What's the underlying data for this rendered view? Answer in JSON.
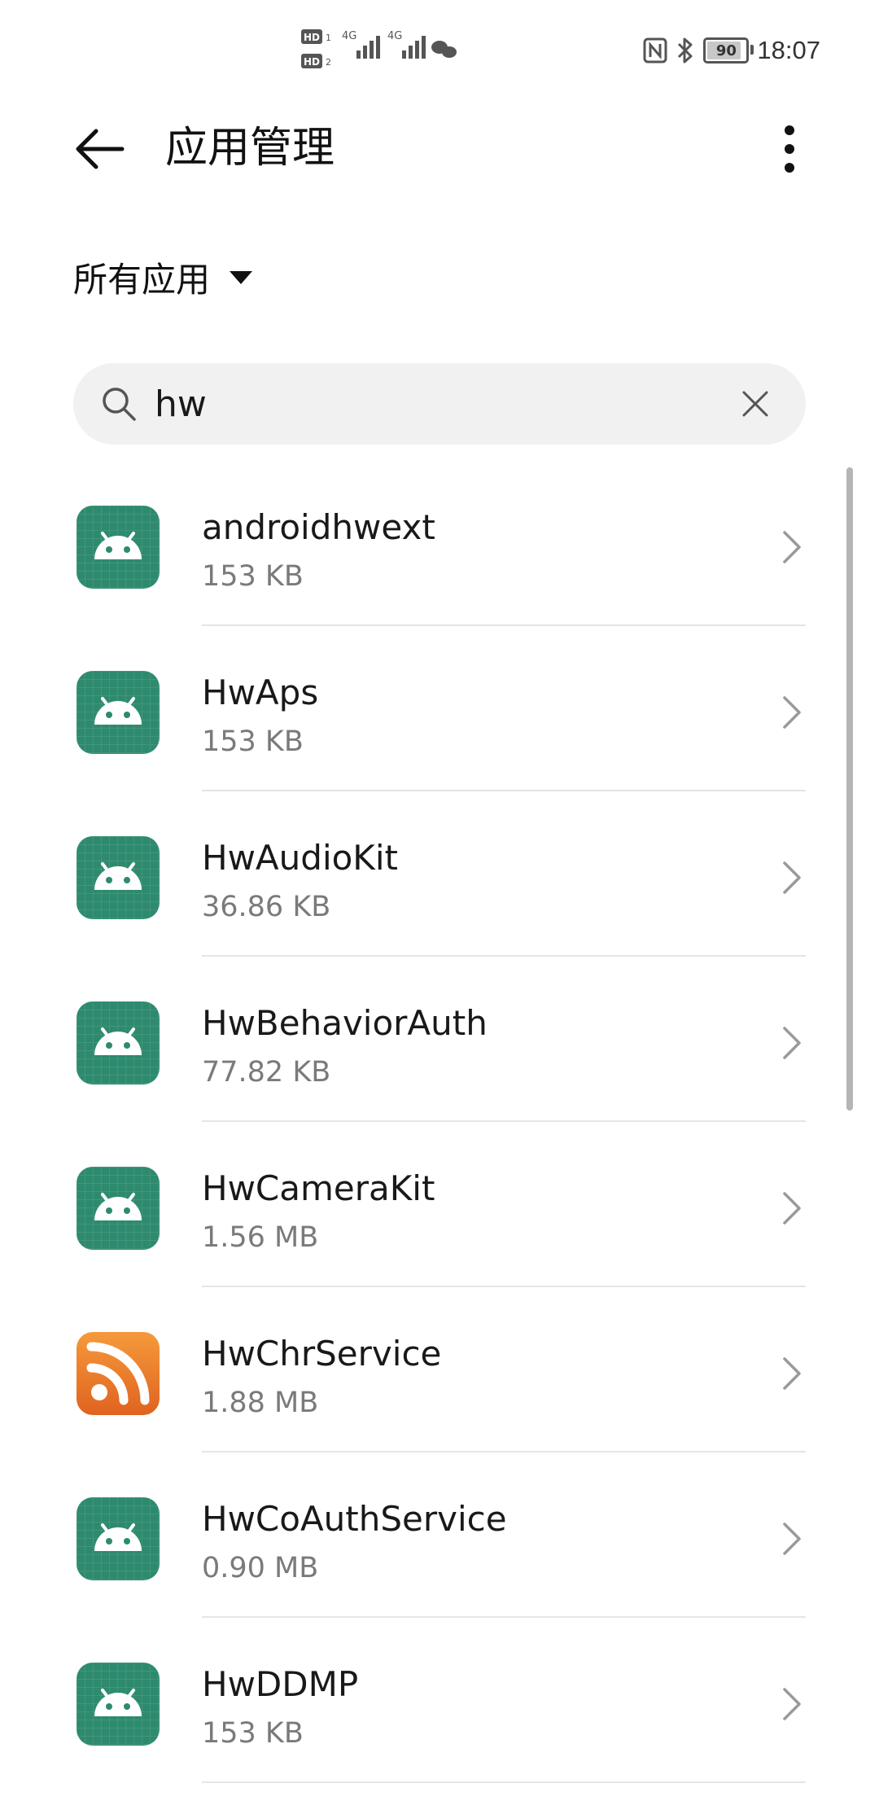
{
  "status_bar": {
    "time": "18:07",
    "battery": "90",
    "battery_level": 0.9,
    "sim1_label": "HD",
    "sim2_label": "HD",
    "net1": "4G",
    "net2": "4G"
  },
  "header": {
    "title": "应用管理"
  },
  "filter": {
    "label": "所有应用"
  },
  "search": {
    "value": "hw"
  },
  "apps": [
    {
      "name": "androidhwext",
      "size": "153 KB",
      "icon": "android-icon"
    },
    {
      "name": "HwAps",
      "size": "153 KB",
      "icon": "android-icon"
    },
    {
      "name": "HwAudioKit",
      "size": "36.86 KB",
      "icon": "android-icon"
    },
    {
      "name": "HwBehaviorAuth",
      "size": "77.82 KB",
      "icon": "android-icon"
    },
    {
      "name": "HwCameraKit",
      "size": "1.56 MB",
      "icon": "android-icon"
    },
    {
      "name": "HwChrService",
      "size": "1.88 MB",
      "icon": "rss-icon"
    },
    {
      "name": "HwCoAuthService",
      "size": "0.90 MB",
      "icon": "android-icon"
    },
    {
      "name": "HwDDMP",
      "size": "153 KB",
      "icon": "android-icon"
    }
  ],
  "colors": {
    "android_icon_bg": "#2e8a6e",
    "rss_icon_bg": "#e0631f",
    "accent_text": "#191919",
    "secondary_text": "#7a7a7a"
  }
}
